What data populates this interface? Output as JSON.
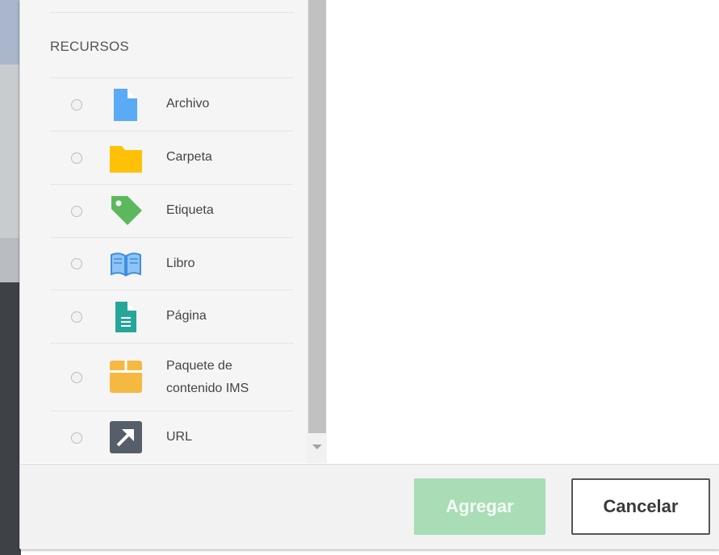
{
  "section_title": "RECURSOS",
  "items": [
    {
      "label": "Archivo",
      "icon": "file-icon",
      "color": "#5aaaf5"
    },
    {
      "label": "Carpeta",
      "icon": "folder-icon",
      "color": "#ffc107"
    },
    {
      "label": "Etiqueta",
      "icon": "tag-icon",
      "color": "#5cb85c"
    },
    {
      "label": "Libro",
      "icon": "book-icon",
      "color": "#4a9ee8"
    },
    {
      "label": "Página",
      "icon": "page-icon",
      "color": "#26a69a"
    },
    {
      "label_line1": "Paquete de",
      "label_line2": "contenido IMS",
      "icon": "package-icon",
      "color": "#f5b942"
    },
    {
      "label": "URL",
      "icon": "link-arrow-icon",
      "color": "#555e69"
    }
  ],
  "buttons": {
    "add": "Agregar",
    "cancel": "Cancelar"
  },
  "colors": {
    "add_button_bg": "#a9ddb5",
    "cancel_border": "#555555"
  }
}
